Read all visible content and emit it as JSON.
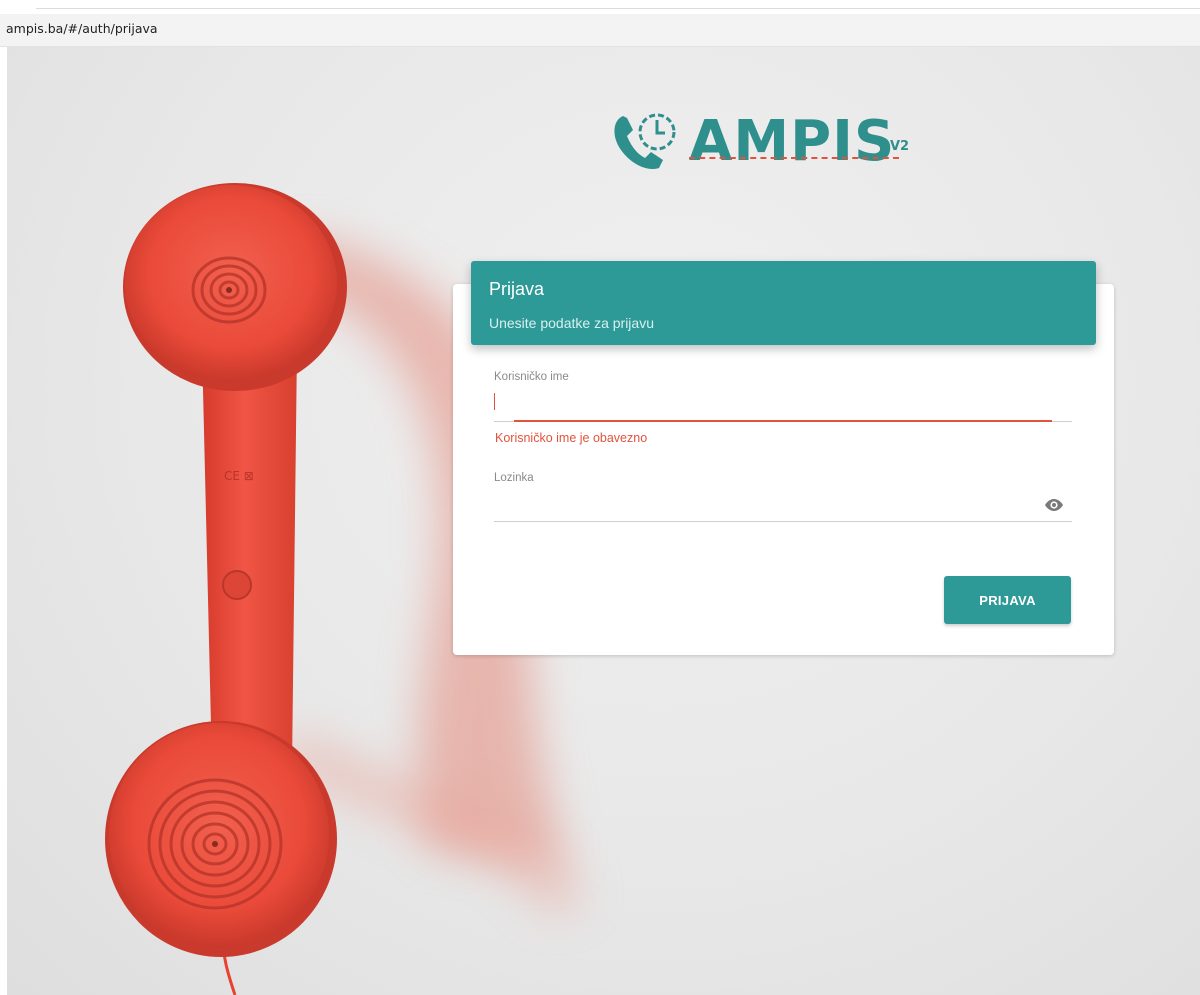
{
  "browser": {
    "url": "ampis.ba/#/auth/prijava"
  },
  "logo": {
    "text": "AMPIS",
    "version": "V2"
  },
  "login": {
    "title": "Prijava",
    "subtitle": "Unesite podatke za prijavu",
    "username_label": "Korisničko ime",
    "username_value": "",
    "username_error": "Korisničko ime je obavezno",
    "password_label": "Lozinka",
    "password_value": "",
    "submit_label": "PRIJAVA"
  },
  "phone_markings": "CE ⊠",
  "colors": {
    "primary": "#2e9a97",
    "error": "#e2533d",
    "phone": "#ee4a3c"
  },
  "icons": {
    "password_toggle": "eye-icon",
    "logo_mark": "phone-clock-icon"
  }
}
